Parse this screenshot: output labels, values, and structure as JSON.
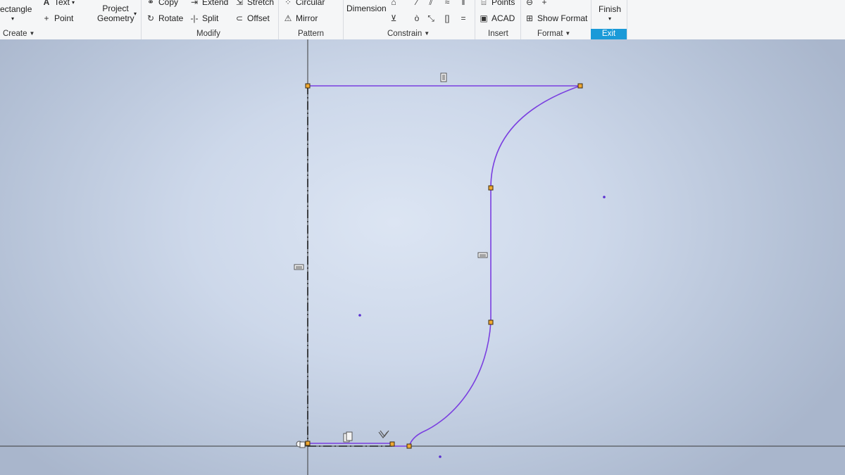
{
  "ribbon": {
    "create": {
      "rectangle_label": "ectangle",
      "text_label": "Text",
      "point_label": "Point",
      "project_geometry_line1": "Project",
      "project_geometry_line2": "Geometry",
      "panel_label": "Create"
    },
    "modify": {
      "copy_label": "Copy",
      "rotate_label": "Rotate",
      "extend_label": "Extend",
      "split_label": "Split",
      "stretch_label": "Stretch",
      "offset_label": "Offset",
      "panel_label": "Modify"
    },
    "pattern": {
      "circular_label": "Circular",
      "mirror_label": "Mirror",
      "panel_label": "Pattern"
    },
    "constrain": {
      "dimension_label": "Dimension",
      "panel_label": "Constrain"
    },
    "insert": {
      "points_label": "Points",
      "acad_label": "ACAD",
      "panel_label": "Insert"
    },
    "format": {
      "show_format_label": "Show Format",
      "panel_label": "Format"
    },
    "exit": {
      "finish_label": "Finish",
      "panel_label": "Exit"
    }
  },
  "colors": {
    "sketch_line": "#7a3fe0",
    "accent": "#1a9ad8",
    "handle_fill": "#f0a830"
  }
}
